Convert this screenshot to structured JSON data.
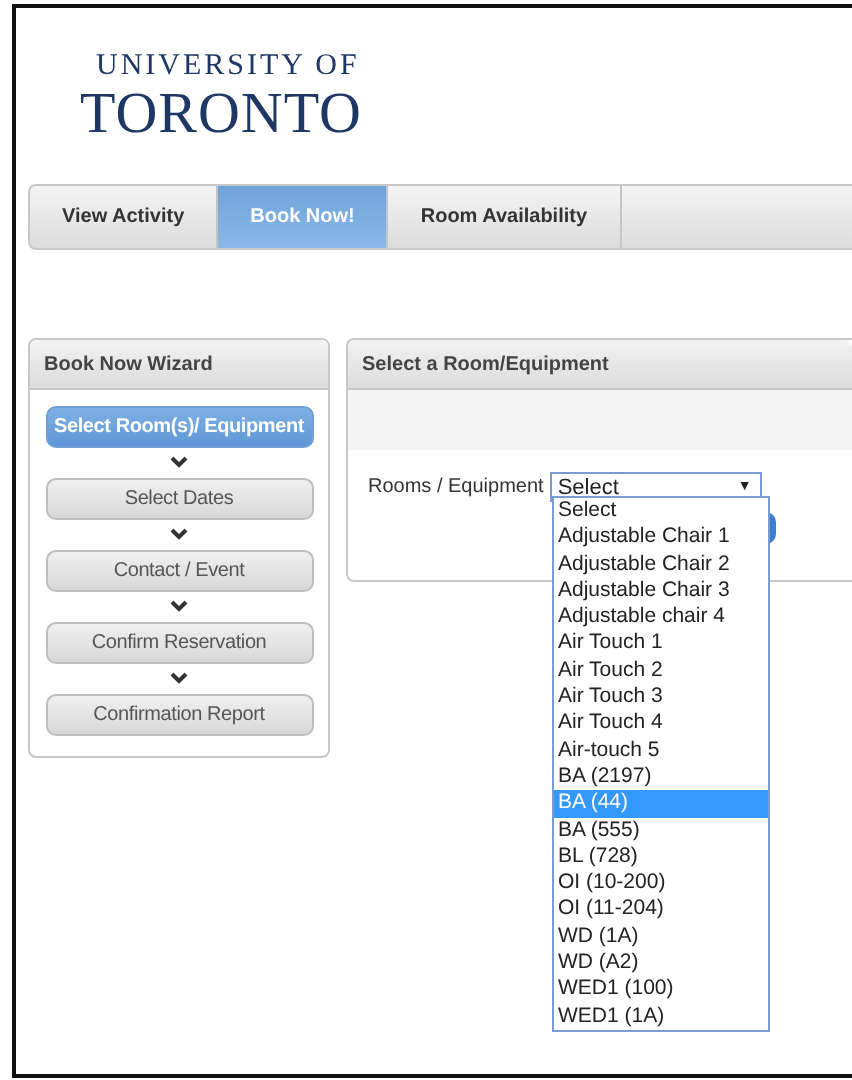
{
  "logo": {
    "line1": "UNIVERSITY OF",
    "line2": "TORONTO"
  },
  "tabs": [
    {
      "label": "View Activity",
      "selected": false
    },
    {
      "label": "Book Now!",
      "selected": true
    },
    {
      "label": "Room Availability",
      "selected": false
    }
  ],
  "wizard": {
    "title": "Book Now Wizard",
    "steps": [
      {
        "label": "Select Room(s)/ Equipment",
        "selected": true
      },
      {
        "label": "Select Dates",
        "selected": false
      },
      {
        "label": "Contact / Event",
        "selected": false
      },
      {
        "label": "Confirm Reservation",
        "selected": false
      },
      {
        "label": "Confirmation Report",
        "selected": false
      }
    ]
  },
  "panel": {
    "title": "Select a Room/Equipment",
    "field_label": "Rooms / Equipment",
    "select_value": "Select",
    "dropdown_arrow": "▼",
    "options": [
      {
        "label": "Select",
        "selected": false
      },
      {
        "label": "Adjustable Chair 1",
        "selected": false
      },
      {
        "label": "Adjustable Chair 2",
        "selected": false
      },
      {
        "label": "Adjustable Chair 3",
        "selected": false
      },
      {
        "label": "Adjustable chair 4",
        "selected": false
      },
      {
        "label": "Air Touch 1",
        "selected": false
      },
      {
        "label": "Air Touch 2",
        "selected": false
      },
      {
        "label": "Air Touch 3",
        "selected": false
      },
      {
        "label": "Air Touch 4",
        "selected": false
      },
      {
        "label": "Air-touch 5",
        "selected": false
      },
      {
        "label": "BA (2197)",
        "selected": false
      },
      {
        "label": "BA (44)",
        "selected": true
      },
      {
        "label": "BA (555)",
        "selected": false
      },
      {
        "label": "BL (728)",
        "selected": false
      },
      {
        "label": "OI (10-200)",
        "selected": false
      },
      {
        "label": "OI (11-204)",
        "selected": false
      },
      {
        "label": "WD (1A)",
        "selected": false
      },
      {
        "label": "WD (A2)",
        "selected": false
      },
      {
        "label": "WED1 (100)",
        "selected": false
      },
      {
        "label": "WED1 (1A)",
        "selected": false
      }
    ]
  }
}
